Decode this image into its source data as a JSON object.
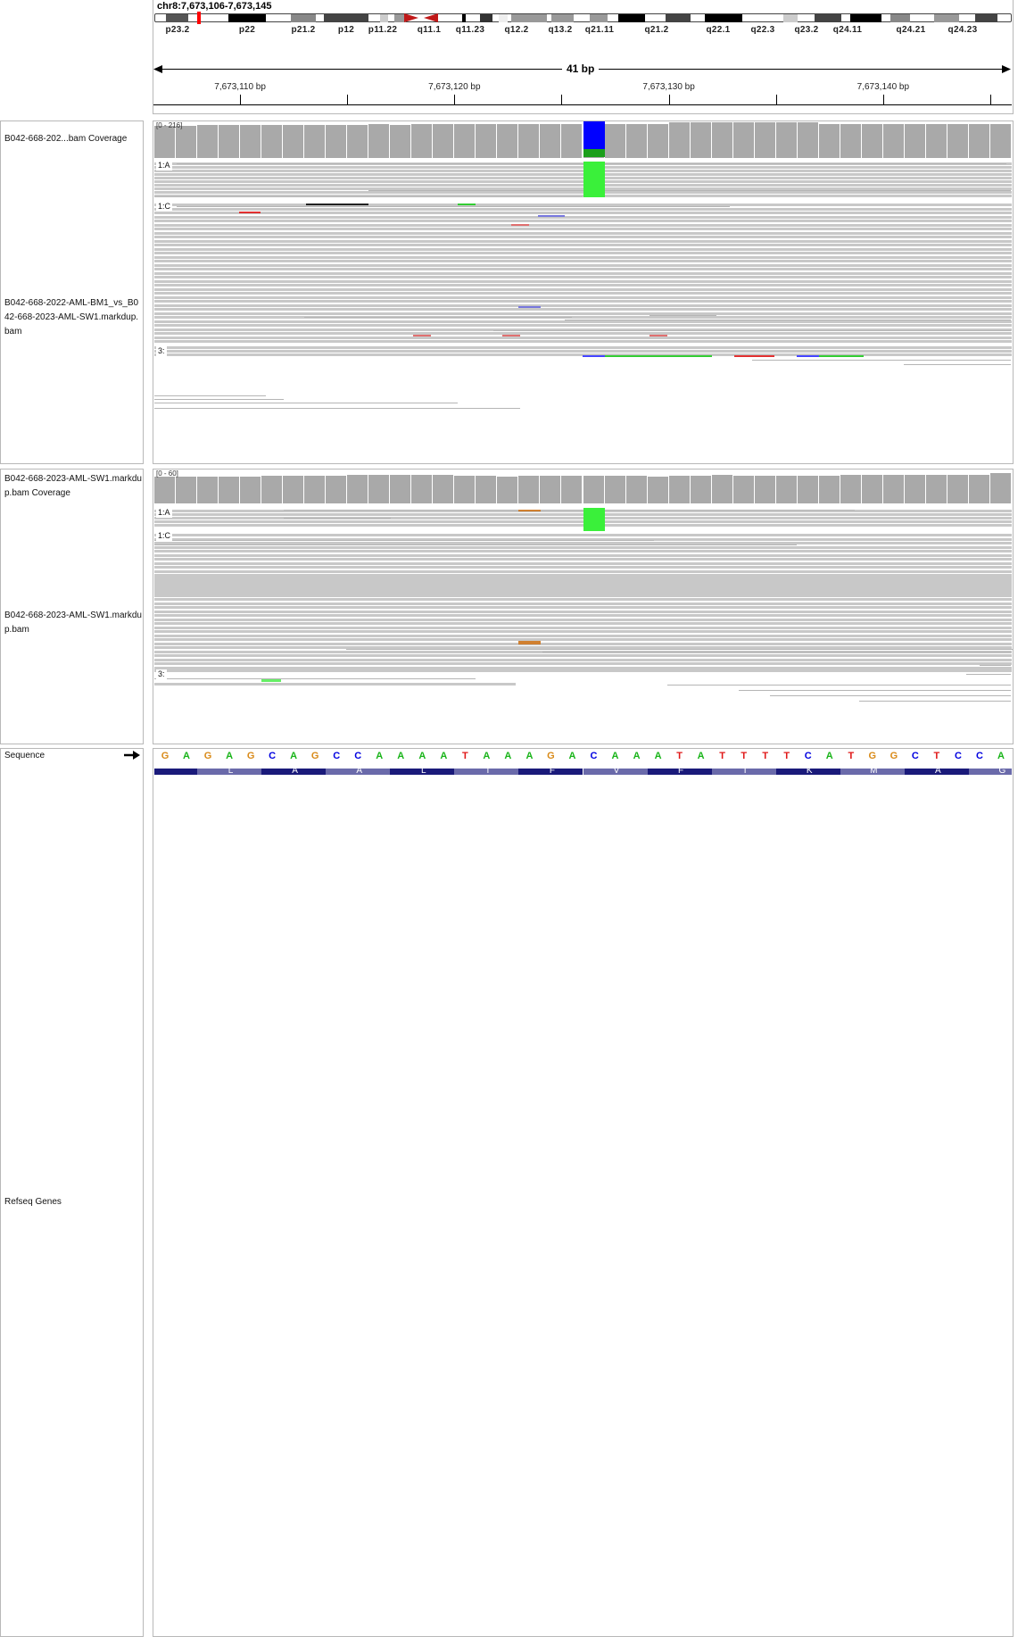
{
  "locus": "chr8:7,673,106-7,673,145",
  "span_label": "41 bp",
  "ruler_ticks": [
    {
      "label": "7,673,110 bp",
      "bp": 7673110
    },
    {
      "label": "7,673,120 bp",
      "bp": 7673120
    },
    {
      "label": "7,673,130 bp",
      "bp": 7673130
    },
    {
      "label": "7,673,140 bp",
      "bp": 7673140
    }
  ],
  "cytobands": [
    "p23.2",
    "p22",
    "p21.2",
    "p12",
    "p11.22",
    "q11.1",
    "q11.23",
    "q12.2",
    "q13.2",
    "q21.11",
    "q21.2",
    "q22.1",
    "q22.3",
    "q23.2",
    "q24.11",
    "q24.21",
    "q24.23"
  ],
  "tracks": {
    "cov1_label": "B042-668-202...bam Coverage",
    "cov1_range": "[0 - 216]",
    "aln1_label": "B042-668-2022-AML-BM1_vs_B042-668-2023-AML-SW1.markdup.bam",
    "cov2_label": "B042-668-2023-AML-SW1.markdup.bam Coverage",
    "cov2_range": "[0 - 60]",
    "aln2_label": "B042-668-2023-AML-SW1.markdup.bam",
    "seq_label": "Sequence",
    "genes_label": "Refseq Genes"
  },
  "group_rows": {
    "a": "1:A",
    "c": "1:C",
    "three": "3:"
  },
  "sequence": [
    "G",
    "A",
    "G",
    "A",
    "G",
    "C",
    "A",
    "G",
    "C",
    "C",
    "A",
    "A",
    "A",
    "A",
    "T",
    "A",
    "A",
    "A",
    "G",
    "A",
    "C",
    "A",
    "A",
    "A",
    "T",
    "A",
    "T",
    "T",
    "T",
    "T",
    "C",
    "A",
    "T",
    "G",
    "G",
    "C",
    "T",
    "C",
    "C",
    "A"
  ],
  "translation": [
    "L",
    "A",
    "A",
    "L",
    "I",
    "F",
    "V",
    "F",
    "I",
    "K",
    "M",
    "A",
    "G"
  ],
  "colors": {
    "A": "#18b418",
    "C": "#0000e0",
    "G": "#d98a18",
    "T": "#e01818",
    "coverage": "#a9a9a9",
    "read": "#c8c8c8",
    "mismatch_c": "#0000ff",
    "mismatch_a": "#33ee33"
  }
}
